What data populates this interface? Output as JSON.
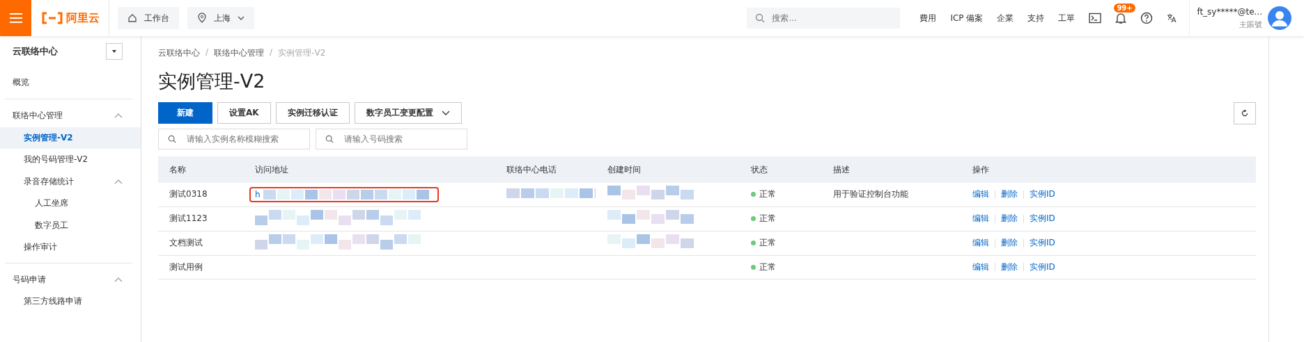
{
  "topbar": {
    "logo": "阿里云",
    "workbench": "工作台",
    "region": "上海",
    "search": {
      "placeholder": "搜索..."
    },
    "links": [
      "費用",
      "ICP 備案",
      "企業",
      "支持",
      "工單"
    ],
    "notification_badge": "99+",
    "account": "ft_sy*****@te...",
    "account_role": "主賬號"
  },
  "sidebar": {
    "title": "云联络中心",
    "items": [
      {
        "label": "概览",
        "kind": "top",
        "selected": false
      },
      {
        "kind": "divider"
      },
      {
        "label": "联络中心管理",
        "kind": "group",
        "expanded": true,
        "selected": false,
        "children": [
          {
            "label": "实例管理-V2",
            "kind": "item",
            "selected": true
          },
          {
            "label": "我的号码管理-V2",
            "kind": "item",
            "selected": false
          },
          {
            "label": "录音存储统计",
            "kind": "group",
            "expanded": true,
            "selected": false,
            "children": [
              {
                "label": "人工坐席",
                "kind": "item",
                "selected": false
              },
              {
                "label": "数字员工",
                "kind": "item",
                "selected": false
              }
            ]
          },
          {
            "label": "操作审计",
            "kind": "item",
            "selected": false
          }
        ]
      },
      {
        "kind": "divider"
      },
      {
        "label": "号码申请",
        "kind": "group",
        "expanded": true,
        "selected": false,
        "children": [
          {
            "label": "第三方线路申请",
            "kind": "item",
            "selected": false
          }
        ]
      }
    ]
  },
  "breadcrumb": [
    "云联络中心",
    "联络中心管理",
    "实例管理-V2"
  ],
  "breadcrumb_separator": "/",
  "page_title": "实例管理-V2",
  "toolbar": [
    {
      "label": "新建",
      "kind": "primary"
    },
    {
      "label": "设置AK",
      "kind": "normal"
    },
    {
      "label": "实例迁移认证",
      "kind": "normal"
    },
    {
      "label": "数字员工变更配置",
      "kind": "dropdown"
    }
  ],
  "filters": [
    {
      "placeholder": "请输入实例名称模糊搜索"
    },
    {
      "placeholder": "请输入号码搜索"
    }
  ],
  "table": {
    "columns": [
      "名称",
      "访问地址",
      "联络中心电话",
      "创建时间",
      "状态",
      "描述",
      "操作"
    ],
    "rows": [
      {
        "name": "测试0318",
        "address": "h",
        "address_highlighted": true,
        "address_redacted": true,
        "phone_redacted": true,
        "created_redacted": true,
        "status": "正常",
        "color": "#6ccb7b",
        "description": "用于验证控制台功能",
        "actions": [
          "编辑",
          "删除",
          "实例ID"
        ]
      },
      {
        "name": "测试1123",
        "address_highlighted": false,
        "address_redacted": true,
        "phone_redacted": false,
        "created_redacted": true,
        "status": "正常",
        "color": "#6ccb7b",
        "actions": [
          "编辑",
          "删除",
          "实例ID"
        ]
      },
      {
        "name": "文档测试",
        "address_highlighted": false,
        "address_redacted": true,
        "phone_redacted": false,
        "created_redacted": true,
        "status": "正常",
        "color": "#6ccb7b",
        "actions": [
          "编辑",
          "删除",
          "实例ID"
        ]
      },
      {
        "name": "测试用例",
        "address_highlighted": false,
        "address_redacted": false,
        "phone_redacted": false,
        "created_redacted": false,
        "status": "正常",
        "color": "#6ccb7b",
        "actions": [
          "编辑",
          "删除",
          "实例ID"
        ]
      }
    ]
  }
}
